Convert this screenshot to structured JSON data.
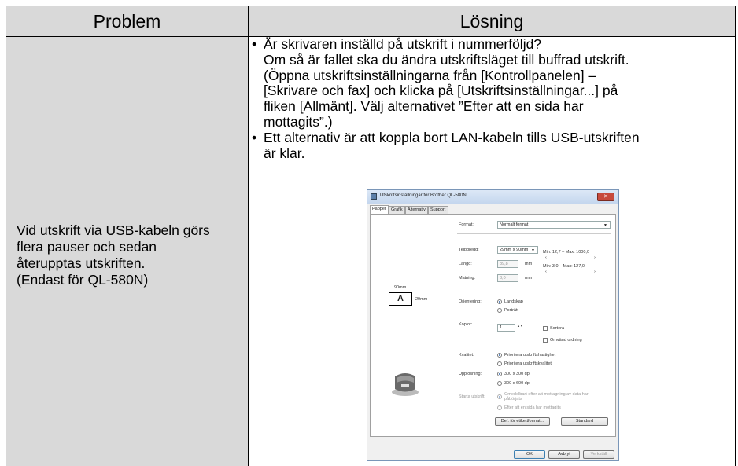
{
  "table": {
    "header_problem": "Problem",
    "header_solution": "Lösning",
    "problem_lines": [
      "Vid utskrift via USB-kabeln görs",
      "flera pauser och sedan",
      "återupptas utskriften.",
      "(Endast för QL-580N)"
    ],
    "bullet_char": "•",
    "solution_bullet1_lines": [
      "Är skrivaren inställd på utskrift i nummerföljd?",
      "Om så är fallet ska du ändra utskriftsläget till buffrad utskrift.",
      "(Öppna utskriftsinställningarna från [Kontrollpanelen] –",
      "[Skrivare och fax] och klicka på [Utskriftsinställningar...] på",
      "fliken [Allmänt]. Välj alternativet ”Efter att en sida har",
      "mottagits”.)"
    ],
    "solution_bullet2_lines": [
      "Ett alternativ är att koppla bort LAN-kabeln tills USB-utskriften",
      "är klar."
    ]
  },
  "dialog": {
    "title": "Utskriftsinställningar för Brother QL-580N",
    "close_glyph": "✕",
    "tabs": [
      "Papper",
      "Grafik",
      "Alternativ",
      "Support"
    ],
    "format_label": "Format:",
    "format_value": "Normalt format",
    "tape_width_label": "Tejpbredd:",
    "tape_width_value": "29mm x 90mm",
    "length_label": "Längd:",
    "length_value": "89,8",
    "length_unit": "mm",
    "length_range": "Min: 12,7 – Max: 1000,0",
    "feed_label": "Matning:",
    "feed_value": "3,0",
    "feed_unit": "mm",
    "feed_range": "Min: 3,0 – Max: 127,0",
    "preview_top_dim": "90mm",
    "preview_side_dim": "29mm",
    "preview_letter": "A",
    "orientation_label": "Orientering:",
    "orientation_landscape": "Landskap",
    "orientation_portrait": "Porträtt",
    "copies_label": "Kopior:",
    "copies_value": "1",
    "collate_label": "Sortera",
    "reverse_label": "Omvänd ordning",
    "quality_label": "Kvalitet:",
    "quality_speed": "Prioritera utskriftshastighet",
    "quality_quality": "Prioritera utskriftskvalitet",
    "resolution_label": "Upplösning:",
    "resolution_1": "300 x 300 dpi",
    "resolution_2": "300 x 600 dpi",
    "start_label": "Starta utskrift:",
    "start_immediate": "Omedelbart efter att mottagning av data har påbörjats",
    "start_after_page": "Efter att en sida har mottagits",
    "btn_label_format": "Def. för etikettformat...",
    "btn_default": "Standard",
    "btn_ok": "OK",
    "btn_cancel": "Avbryt",
    "btn_apply": "Verkställ",
    "spin_arrows": "▲▼",
    "slider_arrows_left": "‹",
    "slider_arrows_right": "›",
    "dropdown_caret": "▼"
  }
}
